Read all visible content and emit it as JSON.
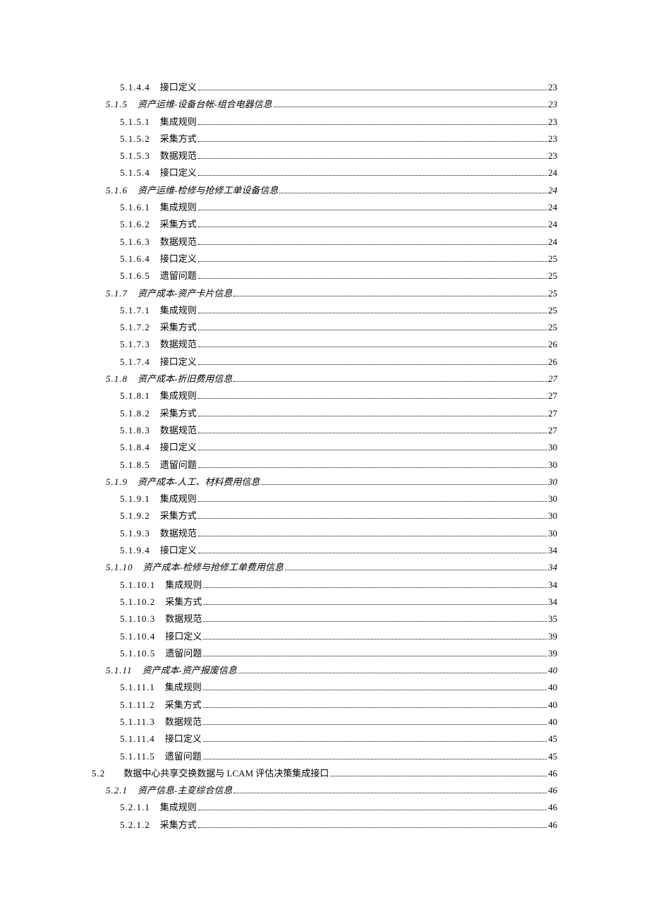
{
  "toc": [
    {
      "level": 3,
      "num": "5.1.4.4",
      "title": "接口定义",
      "page": "23"
    },
    {
      "level": 2,
      "num": "5.1.5",
      "title": "资产运维-设备台帐-组合电器信息",
      "page": "23"
    },
    {
      "level": 3,
      "num": "5.1.5.1",
      "title": "集成规则",
      "page": "23"
    },
    {
      "level": 3,
      "num": "5.1.5.2",
      "title": "采集方式",
      "page": "23"
    },
    {
      "level": 3,
      "num": "5.1.5.3",
      "title": "数据规范",
      "page": "23"
    },
    {
      "level": 3,
      "num": "5.1.5.4",
      "title": "接口定义",
      "page": "24"
    },
    {
      "level": 2,
      "num": "5.1.6",
      "title": "资产运维-检修与抢修工单设备信息",
      "page": "24"
    },
    {
      "level": 3,
      "num": "5.1.6.1",
      "title": "集成规则",
      "page": "24"
    },
    {
      "level": 3,
      "num": "5.1.6.2",
      "title": "采集方式",
      "page": "24"
    },
    {
      "level": 3,
      "num": "5.1.6.3",
      "title": "数据规范",
      "page": "24"
    },
    {
      "level": 3,
      "num": "5.1.6.4",
      "title": "接口定义",
      "page": "25"
    },
    {
      "level": 3,
      "num": "5.1.6.5",
      "title": "遗留问题",
      "page": "25"
    },
    {
      "level": 2,
      "num": "5.1.7",
      "title": "资产成本-资产卡片信息",
      "page": "25"
    },
    {
      "level": 3,
      "num": "5.1.7.1",
      "title": "集成规则",
      "page": "25"
    },
    {
      "level": 3,
      "num": "5.1.7.2",
      "title": "采集方式",
      "page": "25"
    },
    {
      "level": 3,
      "num": "5.1.7.3",
      "title": "数据规范",
      "page": "26"
    },
    {
      "level": 3,
      "num": "5.1.7.4",
      "title": "接口定义",
      "page": "26"
    },
    {
      "level": 2,
      "num": "5.1.8",
      "title": "资产成本-折旧费用信息",
      "page": "27"
    },
    {
      "level": 3,
      "num": "5.1.8.1",
      "title": "集成规则",
      "page": "27"
    },
    {
      "level": 3,
      "num": "5.1.8.2",
      "title": "采集方式",
      "page": "27"
    },
    {
      "level": 3,
      "num": "5.1.8.3",
      "title": "数据规范",
      "page": "27"
    },
    {
      "level": 3,
      "num": "5.1.8.4",
      "title": "接口定义",
      "page": "30"
    },
    {
      "level": 3,
      "num": "5.1.8.5",
      "title": "遗留问题",
      "page": "30"
    },
    {
      "level": 2,
      "num": "5.1.9",
      "title": "资产成本-人工、材料费用信息",
      "page": "30"
    },
    {
      "level": 3,
      "num": "5.1.9.1",
      "title": "集成规则",
      "page": "30"
    },
    {
      "level": 3,
      "num": "5.1.9.2",
      "title": "采集方式",
      "page": "30"
    },
    {
      "level": 3,
      "num": "5.1.9.3",
      "title": "数据规范",
      "page": "30"
    },
    {
      "level": 3,
      "num": "5.1.9.4",
      "title": "接口定义",
      "page": "34"
    },
    {
      "level": 2,
      "num": "5.1.10",
      "title": "资产成本-检修与抢修工单费用信息",
      "page": "34"
    },
    {
      "level": 3,
      "num": "5.1.10.1",
      "title": "集成规则",
      "page": "34"
    },
    {
      "level": 3,
      "num": "5.1.10.2",
      "title": "采集方式",
      "page": "34"
    },
    {
      "level": 3,
      "num": "5.1.10.3",
      "title": "数据规范",
      "page": "35"
    },
    {
      "level": 3,
      "num": "5.1.10.4",
      "title": "接口定义",
      "page": "39"
    },
    {
      "level": 3,
      "num": "5.1.10.5",
      "title": "遗留问题",
      "page": "39"
    },
    {
      "level": 2,
      "num": "5.1.11",
      "title": "资产成本-资产报废信息",
      "page": "40"
    },
    {
      "level": 3,
      "num": "5.1.11.1",
      "title": "集成规则",
      "page": "40"
    },
    {
      "level": 3,
      "num": "5.1.11.2",
      "title": "采集方式",
      "page": "40"
    },
    {
      "level": 3,
      "num": "5.1.11.3",
      "title": "数据规范",
      "page": "40"
    },
    {
      "level": 3,
      "num": "5.1.11.4",
      "title": "接口定义",
      "page": "45"
    },
    {
      "level": 3,
      "num": "5.1.11.5",
      "title": "遗留问题",
      "page": "45"
    },
    {
      "level": 1,
      "num": "5.2",
      "title": "数据中心共享交换数据与 LCAM 评估决策集成接口",
      "page": "46"
    },
    {
      "level": 2,
      "num": "5.2.1",
      "title": "资产信息-主变综合信息",
      "page": "46"
    },
    {
      "level": 3,
      "num": "5.2.1.1",
      "title": "集成规则",
      "page": "46"
    },
    {
      "level": 3,
      "num": "5.2.1.2",
      "title": "采集方式",
      "page": "46"
    }
  ]
}
